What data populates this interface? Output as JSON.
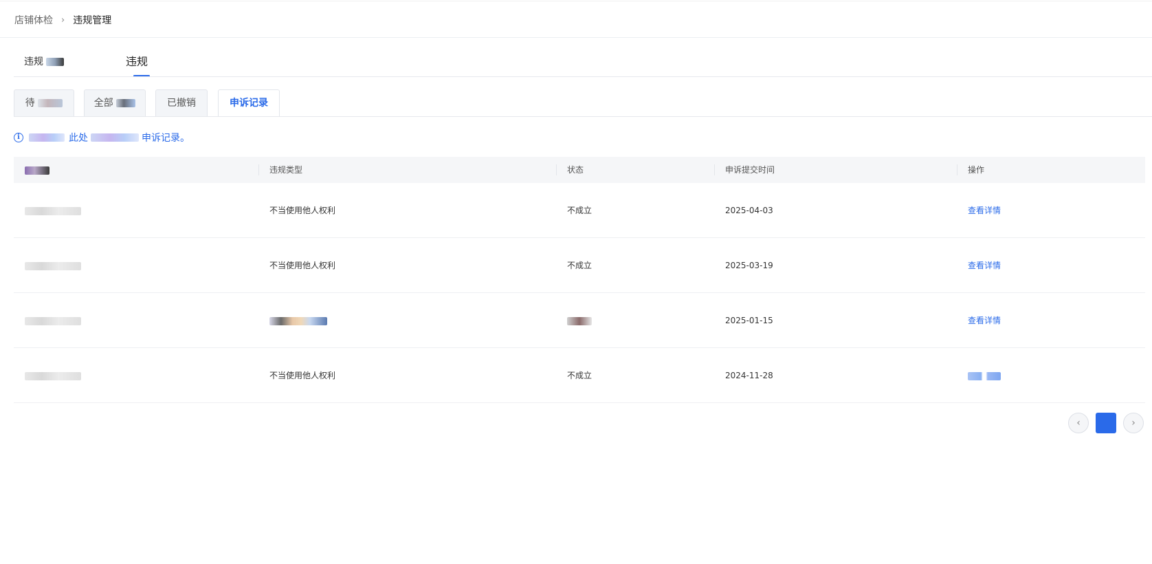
{
  "breadcrumb": {
    "parent": "店铺体检",
    "separator": "›",
    "current": "违规管理"
  },
  "main_tabs": [
    {
      "label": "违规"
    },
    {
      "label": "违规",
      "active": true
    }
  ],
  "sub_tabs": [
    {
      "label": "待"
    },
    {
      "label": "全部"
    },
    {
      "label": "已撤销"
    },
    {
      "label": "申诉记录",
      "active": true
    }
  ],
  "notice": {
    "icon": "info-icon",
    "text": "此处",
    "text_tail": "申诉记录。"
  },
  "table": {
    "columns": [
      "",
      "违规类型",
      "状态",
      "申诉提交时间",
      "操作"
    ],
    "rows": [
      {
        "type": "不当使用他人权利",
        "status": "不成立",
        "date": "2025-04-03",
        "action": "查看详情"
      },
      {
        "type": "不当使用他人权利",
        "status": "不成立",
        "date": "2025-03-19",
        "action": "查看详情"
      },
      {
        "type": "",
        "status": "",
        "date": "2025-01-15",
        "action": "查看详情"
      },
      {
        "type": "不当使用他人权利",
        "status": "不成立",
        "date": "2024-11-28",
        "action": ""
      }
    ]
  },
  "pagination": {
    "prev": "‹",
    "next": "›",
    "current": ""
  },
  "colors": {
    "accent": "#2a6ae9",
    "header_bg": "#f5f6f8",
    "tab_bg": "#f3f5f8"
  }
}
